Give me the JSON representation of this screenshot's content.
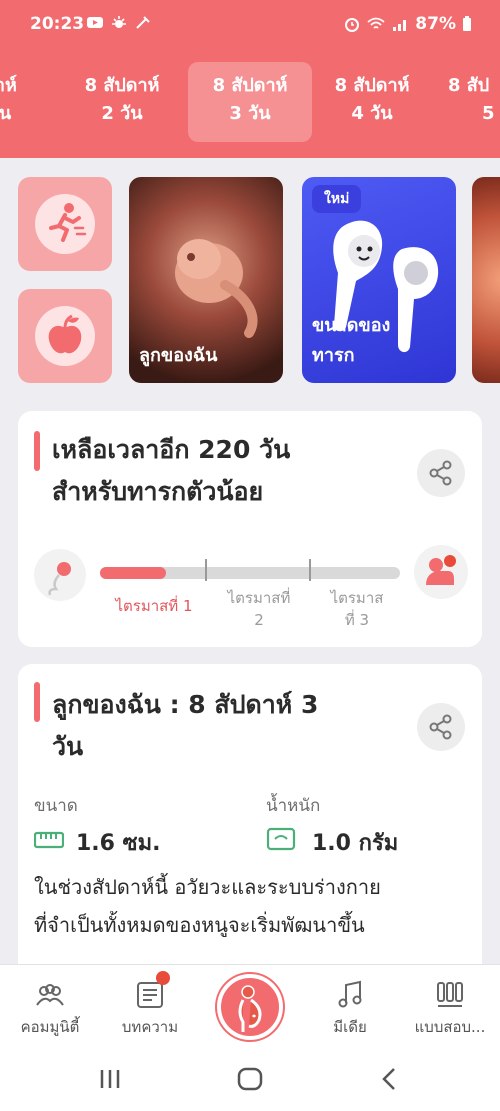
{
  "status": {
    "time": "20:23",
    "battery": "87%"
  },
  "weeks": [
    {
      "line1": "ดาห์",
      "line2": "วัน"
    },
    {
      "line1": "8 สัปดาห์",
      "line2": "2 วัน"
    },
    {
      "line1": "8 สัปดาห์",
      "line2": "3 วัน"
    },
    {
      "line1": "8 สัปดาห์",
      "line2": "4 วัน"
    },
    {
      "line1": "8 สัป",
      "line2": "5"
    }
  ],
  "cards": {
    "baby_label": "ลูกของฉัน",
    "size_label_1": "ขนาดของ",
    "size_label_2": "ทารก",
    "new_badge": "ใหม่"
  },
  "countdown": {
    "title_line1": "เหลือเวลาอีก 220 วัน",
    "title_line2": "สำหรับทารกตัวน้อย",
    "progress": 0.22,
    "trimesters": [
      {
        "line1": "ไตรมาสที่ 1",
        "line2": ""
      },
      {
        "line1": "ไตรมาสที่",
        "line2": "2"
      },
      {
        "line1": "ไตรมาส",
        "line2": "ที่ 3"
      }
    ]
  },
  "baby_info": {
    "title_line1": "ลูกของฉัน : 8 สัปดาห์ 3",
    "title_line2": "วัน",
    "size_label": "ขนาด",
    "size_value": "1.6 ซม.",
    "weight_label": "น้ำหนัก",
    "weight_value": "1.0 กรัม",
    "description_line1": "ในช่วงสัปดาห์นี้ อวัยวะและระบบร่างกาย",
    "description_line2": "ที่จำเป็นทั้งหมดของหนูจะเริ่มพัฒนาขึ้น"
  },
  "nav": {
    "community": "คอมมูนิตี้",
    "articles": "บทความ",
    "media": "มีเดีย",
    "quiz": "แบบสอบ..."
  },
  "colors": {
    "primary": "#F26B6F",
    "badge": "#3B3FDD"
  }
}
